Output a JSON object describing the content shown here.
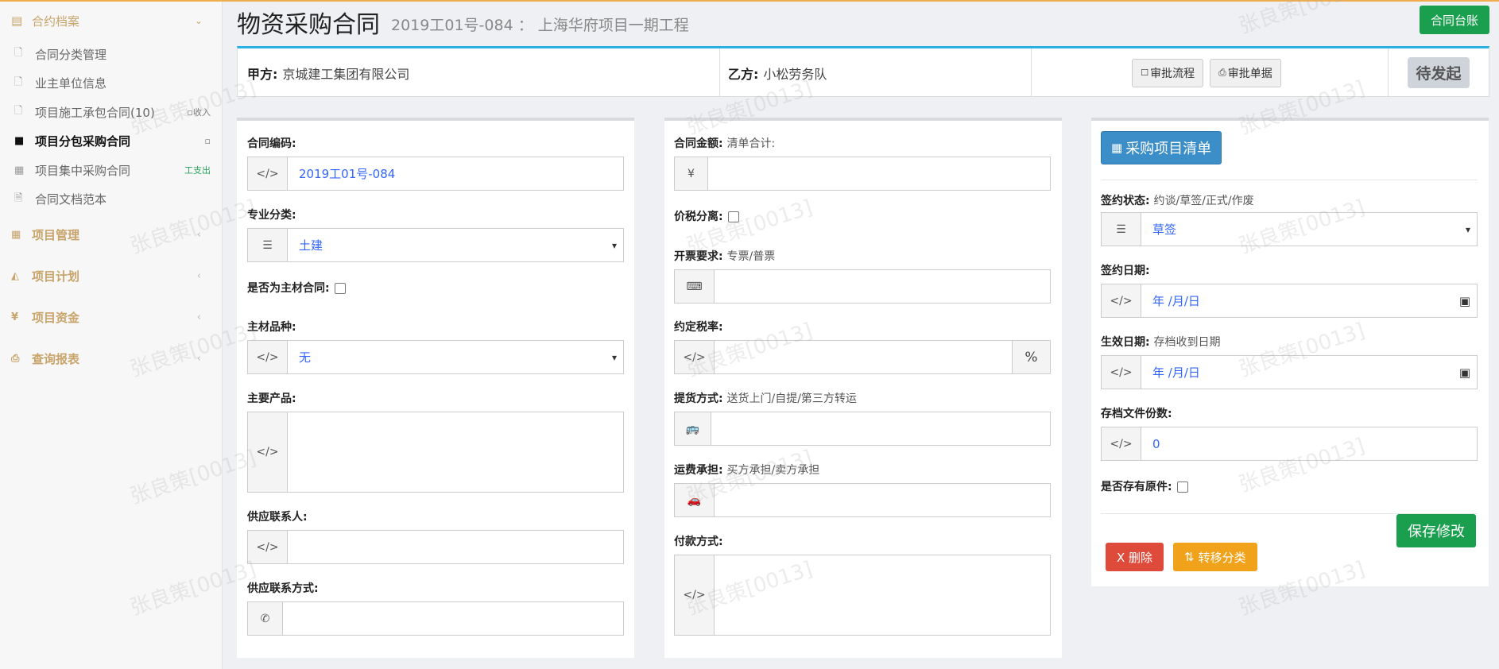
{
  "sidebar": {
    "section_header": "合约档案",
    "sub_items": [
      {
        "label": "合同分类管理",
        "icon": "file-icon",
        "tag": ""
      },
      {
        "label": "业主单位信息",
        "icon": "file-icon",
        "tag": ""
      },
      {
        "label": "项目施工承包合同(10)",
        "icon": "file-icon",
        "tag": "收入"
      },
      {
        "label": "项目分包采购合同",
        "icon": "briefcase-icon",
        "tag": ""
      },
      {
        "label": "项目集中采购合同",
        "icon": "calculator-icon",
        "tag": "支出"
      },
      {
        "label": "合同文档范本",
        "icon": "word-file-icon",
        "tag": ""
      }
    ],
    "groups": [
      {
        "label": "项目管理",
        "icon": "calendar-icon"
      },
      {
        "label": "项目计划",
        "icon": "area-chart-icon"
      },
      {
        "label": "项目资金",
        "icon": "yen-icon"
      },
      {
        "label": "查询报表",
        "icon": "print-icon"
      }
    ]
  },
  "header": {
    "title": "物资采购合同",
    "subtitle": "2019工01号-084 ： 上海华府项目一期工程",
    "ledger_button": "合同台账"
  },
  "party": {
    "party_a_label": "甲方:",
    "party_a_value": "京城建工集团有限公司",
    "party_b_label": "乙方:",
    "party_b_value": "小松劳务队",
    "approval_flow_button": "审批流程",
    "approval_doc_button": "审批单据",
    "status": "待发起"
  },
  "left_panel": {
    "contract_no_label": "合同编码:",
    "contract_no_value": "2019工01号-084",
    "specialty_label": "专业分类:",
    "specialty_value": "土建",
    "is_main_material_label": "是否为主材合同:",
    "main_material_label": "主材品种:",
    "main_material_value": "无",
    "main_product_label": "主要产品:",
    "supplier_contact_label": "供应联系人:",
    "supplier_phone_label": "供应联系方式:"
  },
  "middle_panel": {
    "amount_label": "合同金额:",
    "amount_hint": "清单合计:",
    "amount_prefix": "¥",
    "tax_separate_label": "价税分离:",
    "invoice_label": "开票要求:",
    "invoice_hint": "专票/普票",
    "tax_rate_label": "约定税率:",
    "tax_rate_suffix": "%",
    "delivery_label": "提货方式:",
    "delivery_hint": "送货上门/自提/第三方转运",
    "freight_label": "运费承担:",
    "freight_hint": "买方承担/卖方承担",
    "payment_label": "付款方式:"
  },
  "right_panel": {
    "list_button": "采购项目清单",
    "sign_status_label": "签约状态:",
    "sign_status_hint": "约谈/草签/正式/作废",
    "sign_status_value": "草签",
    "sign_date_label": "签约日期:",
    "sign_date_placeholder": "年 /月/日",
    "effective_date_label": "生效日期:",
    "effective_date_hint": "存档收到日期",
    "effective_date_placeholder": "年 /月/日",
    "archive_copies_label": "存档文件份数:",
    "archive_copies_value": "0",
    "has_original_label": "是否存有原件:",
    "save_button": "保存修改",
    "delete_button": "X 删除",
    "move_button": "转移分类"
  },
  "watermark_text": "张良策[0013]",
  "colors": {
    "accent": "#29b0e5",
    "brand_gold": "#c8a46a",
    "success": "#1a9f4e",
    "danger": "#df4b3a",
    "warning": "#f1a21b"
  }
}
